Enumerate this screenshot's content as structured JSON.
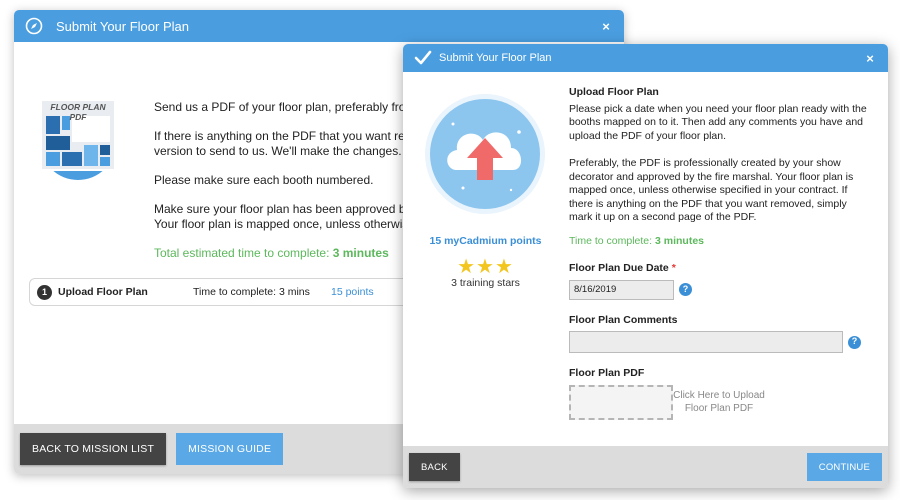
{
  "back_window": {
    "title": "Submit Your Floor Plan",
    "close": "×",
    "illustration_label": "FLOOR PLAN PDF",
    "paragraphs": [
      "Send us a PDF of your floor plan, preferably from your show",
      "If there is anything on the PDF that you want removed, simply mark it up and send a\nversion to send to us. We'll make the changes.",
      "Please make sure each booth numbered.",
      "Make sure your floor plan has been approved by the fire marshal.\nYour floor plan is mapped once, unless otherwise specified."
    ],
    "time_prefix": "Total estimated time to complete: ",
    "time_value": "3 minutes",
    "mission": {
      "number": "1",
      "name": "Upload Floor Plan",
      "time": "Time to complete: 3 mins",
      "points": "15 points"
    },
    "footer": {
      "back_label": "BACK TO MISSION LIST",
      "guide_label": "MISSION GUIDE"
    }
  },
  "front_window": {
    "title": "Submit Your Floor Plan",
    "close": "×",
    "points": "15 myCadmium points",
    "stars": "★★★",
    "stars_label": "3 training stars",
    "heading": "Upload Floor Plan",
    "paragraph1": "Please pick a date when you need your floor plan ready with the booths mapped on to it. Then add any comments you have and upload the PDF of your floor plan.",
    "paragraph2": "Preferably, the PDF is professionally created by your show decorator and approved by the fire marshal. Your floor plan is mapped once, unless otherwise specified in your contract. If there is anything on the PDF that you want removed, simply mark it up on a second page of the PDF.",
    "time_prefix": "Time to complete: ",
    "time_value": "3 minutes",
    "due_date_label": "Floor Plan Due Date",
    "required_mark": "*",
    "due_date_value": "8/16/2019",
    "comments_label": "Floor Plan Comments",
    "comments_value": "",
    "help_glyph": "?",
    "pdf_label": "Floor Plan PDF",
    "upload_text": "Click Here to Upload Floor Plan PDF",
    "footer": {
      "back_label": "BACK",
      "continue_label": "CONTINUE"
    }
  },
  "colors": {
    "title_bar": "#4a9ee0",
    "accent_blue": "#3a8fd6",
    "success_green": "#5cb85c",
    "required_red": "#e53935",
    "star_yellow": "#f3c61f"
  }
}
